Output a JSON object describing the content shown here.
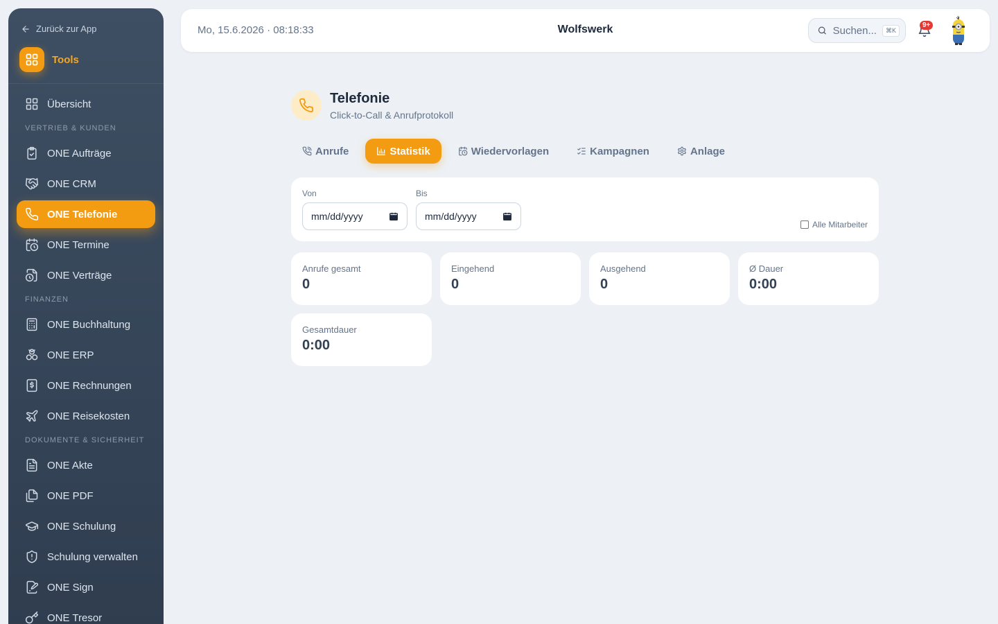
{
  "sidebar": {
    "back_label": "Zurück zur App",
    "tools_label": "Tools",
    "items": [
      {
        "type": "item",
        "label": "Übersicht",
        "icon": "grid-icon",
        "active": false
      },
      {
        "type": "section",
        "label": "VERTRIEB & KUNDEN"
      },
      {
        "type": "item",
        "label": "ONE Aufträge",
        "icon": "clipboard-check-icon",
        "active": false
      },
      {
        "type": "item",
        "label": "ONE CRM",
        "icon": "handshake-icon",
        "active": false
      },
      {
        "type": "item",
        "label": "ONE Telefonie",
        "icon": "phone-icon",
        "active": true
      },
      {
        "type": "item",
        "label": "ONE Termine",
        "icon": "calendar-clock-icon",
        "active": false
      },
      {
        "type": "item",
        "label": "ONE Verträge",
        "icon": "file-clock-icon",
        "active": false
      },
      {
        "type": "section",
        "label": "FINANZEN"
      },
      {
        "type": "item",
        "label": "ONE Buchhaltung",
        "icon": "calculator-icon",
        "active": false
      },
      {
        "type": "item",
        "label": "ONE ERP",
        "icon": "boxes-icon",
        "active": false
      },
      {
        "type": "item",
        "label": "ONE Rechnungen",
        "icon": "receipt-dollar-icon",
        "active": false
      },
      {
        "type": "item",
        "label": "ONE Reisekosten",
        "icon": "plane-icon",
        "active": false
      },
      {
        "type": "section",
        "label": "DOKUMENTE & SICHERHEIT"
      },
      {
        "type": "item",
        "label": "ONE Akte",
        "icon": "file-text-icon",
        "active": false
      },
      {
        "type": "item",
        "label": "ONE PDF",
        "icon": "files-icon",
        "active": false
      },
      {
        "type": "item",
        "label": "ONE Schulung",
        "icon": "graduation-cap-icon",
        "active": false
      },
      {
        "type": "item",
        "label": "Schulung verwalten",
        "icon": "shield-alert-icon",
        "active": false
      },
      {
        "type": "item",
        "label": "ONE Sign",
        "icon": "file-signature-icon",
        "active": false
      },
      {
        "type": "item",
        "label": "ONE Tresor",
        "icon": "key-icon",
        "active": false
      }
    ]
  },
  "topbar": {
    "datetime": "Mo, 15.6.2026 · 08:18:33",
    "company": "Wolfswerk",
    "search_placeholder": "Suchen...",
    "search_shortcut": "⌘K",
    "notification_badge": "9+"
  },
  "page": {
    "title": "Telefonie",
    "subtitle": "Click-to-Call & Anrufprotokoll"
  },
  "tabs": [
    {
      "label": "Anrufe",
      "icon": "phone-call-icon",
      "active": false
    },
    {
      "label": "Statistik",
      "icon": "bar-chart-icon",
      "active": true
    },
    {
      "label": "Wiedervorlagen",
      "icon": "calendar-clock-icon",
      "active": false
    },
    {
      "label": "Kampagnen",
      "icon": "list-checks-icon",
      "active": false
    },
    {
      "label": "Anlage",
      "icon": "gear-icon",
      "active": false
    }
  ],
  "filters": {
    "from_label": "Von",
    "from_value": "mm/dd/yyyy",
    "to_label": "Bis",
    "to_value": "mm/dd/yyyy",
    "all_employees_label": "Alle Mitarbeiter",
    "all_employees_checked": false
  },
  "stats": [
    {
      "label": "Anrufe gesamt",
      "value": "0"
    },
    {
      "label": "Eingehend",
      "value": "0"
    },
    {
      "label": "Ausgehend",
      "value": "0"
    },
    {
      "label": "Ø Dauer",
      "value": "0:00"
    },
    {
      "label": "Gesamtdauer",
      "value": "0:00"
    }
  ],
  "colors": {
    "accent": "#f39c12",
    "sidebar": "#34455a",
    "background": "#edf1f5"
  }
}
